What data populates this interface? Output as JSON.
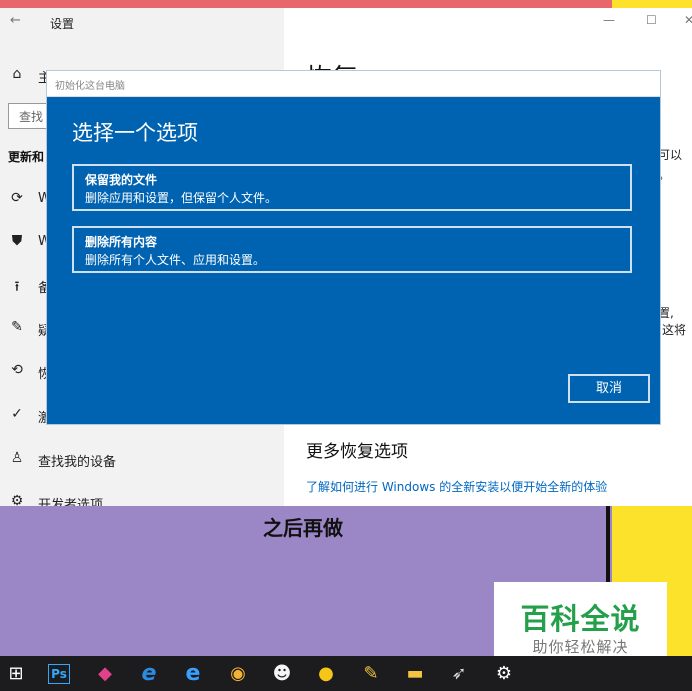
{
  "settings": {
    "title": "设置",
    "back_glyph": "←",
    "minimize_glyph": "—",
    "maximize_glyph": "☐",
    "close_glyph": "✕",
    "home_label": "主页",
    "search_placeholder": "查找",
    "section_header": "更新和",
    "nav": [
      {
        "icon": "sync-icon",
        "glyph": "⟳",
        "label": "W"
      },
      {
        "icon": "shield-icon",
        "glyph": "⛊",
        "label": "W"
      },
      {
        "icon": "backup-arrow-icon",
        "glyph": "⭱",
        "label": "备"
      },
      {
        "icon": "wrench-icon",
        "glyph": "✎",
        "label": "疑"
      },
      {
        "icon": "recovery-icon",
        "glyph": "⟲",
        "label": "恢"
      },
      {
        "icon": "activation-check-icon",
        "glyph": "✓",
        "label": "激"
      },
      {
        "icon": "find-device-icon",
        "glyph": "♙",
        "label": "查找我的设备"
      },
      {
        "icon": "developer-icon",
        "glyph": "⚙",
        "label": "开发者选项"
      }
    ],
    "main_title": "恢复",
    "right_text_a": "可以",
    "right_text_b": "。",
    "right_text_c": "置,",
    "right_text_d": "这将",
    "more_options_heading": "更多恢复选项",
    "more_options_link": "了解如何进行 Windows 的全新安装以便开始全新的体验"
  },
  "dialog": {
    "window_title": "初始化这台电脑",
    "heading": "选择一个选项",
    "options": [
      {
        "title": "保留我的文件",
        "desc": "删除应用和设置，但保留个人文件。"
      },
      {
        "title": "删除所有内容",
        "desc": "删除所有个人文件、应用和设置。"
      }
    ],
    "cancel_label": "取消"
  },
  "caption": "之后再做",
  "brand": {
    "main": "百科全说",
    "sub": "助你轻松解决"
  },
  "taskbar": {
    "items": [
      {
        "icon": "windows-start-icon",
        "glyph": "⊞",
        "color": "#ffffff"
      },
      {
        "icon": "photoshop-icon",
        "glyph": "Ps",
        "color": "#31a8ff"
      },
      {
        "icon": "paint-3d-icon",
        "glyph": "◆",
        "color": "#e0428a"
      },
      {
        "icon": "internet-explorer-icon",
        "glyph": "e",
        "color": "#2b8be0"
      },
      {
        "icon": "edge-icon",
        "glyph": "e",
        "color": "#3aa0ff"
      },
      {
        "icon": "chrome-icon",
        "glyph": "◉",
        "color": "#f2b233"
      },
      {
        "icon": "qq-icon",
        "glyph": "☻",
        "color": "#f5f5f5"
      },
      {
        "icon": "music-app-icon",
        "glyph": "●",
        "color": "#f5c518"
      },
      {
        "icon": "cleaner-broom-icon",
        "glyph": "✎",
        "color": "#f0c23a"
      },
      {
        "icon": "file-explorer-icon",
        "glyph": "▬",
        "color": "#f6c443"
      },
      {
        "icon": "rocket-icon",
        "glyph": "➶",
        "color": "#d9d9d9"
      },
      {
        "icon": "settings-gear-icon",
        "glyph": "⚙",
        "color": "#ffffff"
      }
    ]
  }
}
